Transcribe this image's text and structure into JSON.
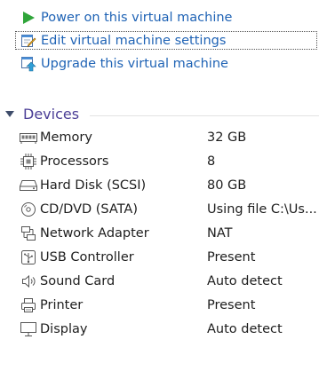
{
  "actions": {
    "power_on": {
      "label": "Power on this virtual machine",
      "icon": "play-icon"
    },
    "edit_settings": {
      "label": "Edit virtual machine settings",
      "icon": "edit-settings-icon"
    },
    "upgrade": {
      "label": "Upgrade this virtual machine",
      "icon": "upgrade-icon"
    }
  },
  "devices": {
    "title": "Devices",
    "items": [
      {
        "name": "Memory",
        "value": "32 GB",
        "icon": "memory-icon"
      },
      {
        "name": "Processors",
        "value": "8",
        "icon": "processor-icon"
      },
      {
        "name": "Hard Disk (SCSI)",
        "value": "80 GB",
        "icon": "hard-disk-icon"
      },
      {
        "name": "CD/DVD (SATA)",
        "value": "Using file C:\\Us...",
        "icon": "cd-dvd-icon"
      },
      {
        "name": "Network Adapter",
        "value": "NAT",
        "icon": "network-adapter-icon"
      },
      {
        "name": "USB Controller",
        "value": "Present",
        "icon": "usb-icon"
      },
      {
        "name": "Sound Card",
        "value": "Auto detect",
        "icon": "speaker-icon"
      },
      {
        "name": "Printer",
        "value": "Present",
        "icon": "printer-icon"
      },
      {
        "name": "Display",
        "value": "Auto detect",
        "icon": "display-icon"
      }
    ]
  },
  "colors": {
    "link": "#1f63b5",
    "section_title": "#4b3e96",
    "play_green": "#2fa53a",
    "text": "#1e1e1e"
  }
}
